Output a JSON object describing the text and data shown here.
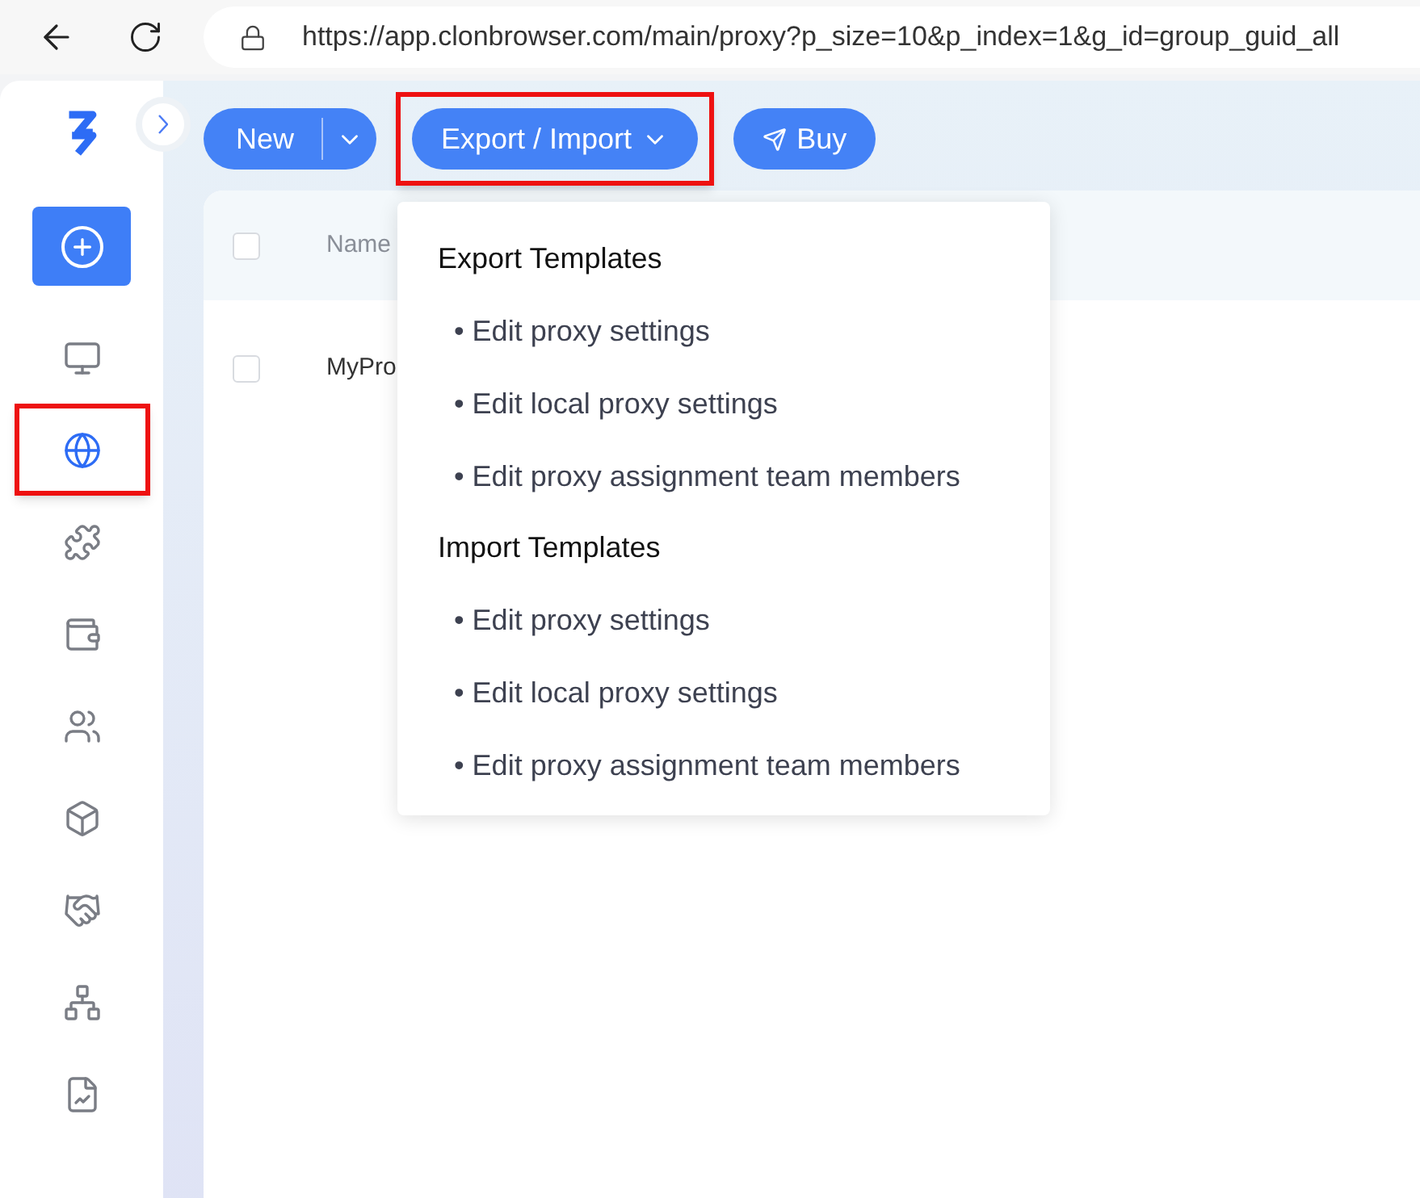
{
  "browser": {
    "url": "https://app.clonbrowser.com/main/proxy?p_size=10&p_index=1&g_id=group_guid_all"
  },
  "sidebar": {
    "items": [
      {
        "kind": "monitor",
        "selected": false,
        "highlighted": false
      },
      {
        "kind": "globe",
        "selected": true,
        "highlighted": true
      },
      {
        "kind": "puzzle",
        "selected": false,
        "highlighted": false
      },
      {
        "kind": "wallet",
        "selected": false,
        "highlighted": false
      },
      {
        "kind": "users",
        "selected": false,
        "highlighted": false
      },
      {
        "kind": "box",
        "selected": false,
        "highlighted": false
      },
      {
        "kind": "handshake",
        "selected": false,
        "highlighted": false
      },
      {
        "kind": "network",
        "selected": false,
        "highlighted": false
      },
      {
        "kind": "report",
        "selected": false,
        "highlighted": false
      }
    ]
  },
  "toolbar": {
    "new_button": "New",
    "export_button": {
      "label": "Export / Import",
      "highlighted": true
    },
    "buy_button": "Buy"
  },
  "table": {
    "columns": [
      "Name"
    ],
    "rows": [
      {
        "cells": [
          "MyPro"
        ],
        "checked": false
      }
    ],
    "header_checked": false
  },
  "dropdown": {
    "sections": [
      {
        "title": "Export Templates",
        "items": [
          "• Edit proxy settings",
          "• Edit local proxy settings",
          "• Edit proxy assignment team members"
        ]
      },
      {
        "title": "Import Templates",
        "items": [
          "• Edit proxy settings",
          "• Edit local proxy settings",
          "• Edit proxy assignment team members"
        ]
      }
    ]
  }
}
